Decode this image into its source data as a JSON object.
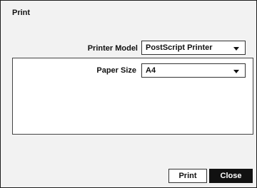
{
  "dialog": {
    "title": "Print"
  },
  "printer_model": {
    "label": "Printer Model",
    "value": "PostScript Printer"
  },
  "paper_size": {
    "label": "Paper Size",
    "value": "A4"
  },
  "buttons": {
    "print": "Print",
    "close": "Close"
  }
}
